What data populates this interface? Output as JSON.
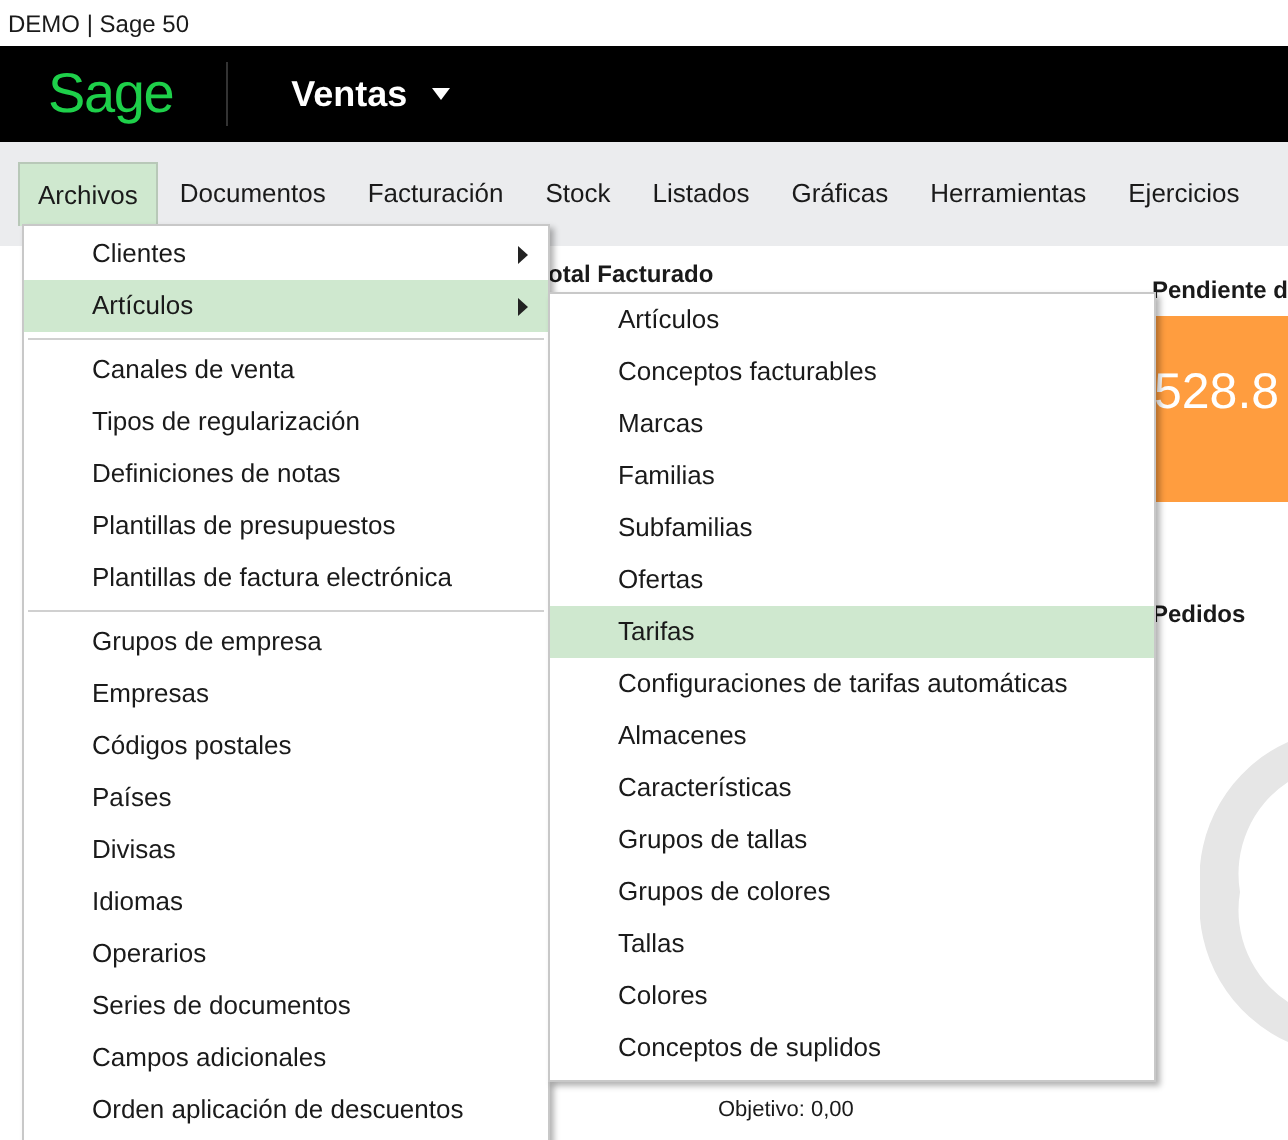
{
  "window": {
    "title": "DEMO | Sage 50"
  },
  "header": {
    "logo": "Sage",
    "module": "Ventas"
  },
  "menubar": [
    {
      "label": "Archivos",
      "selected": true
    },
    {
      "label": "Documentos",
      "selected": false
    },
    {
      "label": "Facturación",
      "selected": false
    },
    {
      "label": "Stock",
      "selected": false
    },
    {
      "label": "Listados",
      "selected": false
    },
    {
      "label": "Gráficas",
      "selected": false
    },
    {
      "label": "Herramientas",
      "selected": false
    },
    {
      "label": "Ejercicios",
      "selected": false
    }
  ],
  "dashboard": {
    "total_heading": "otal Facturado",
    "pending_heading": "Pendiente d",
    "pending_value": "528.8",
    "orders_heading": "Pedidos",
    "target": "Objetivo: 0,00"
  },
  "menu": {
    "items": [
      {
        "kind": "item",
        "label": "Clientes",
        "has_submenu": true,
        "selected": false
      },
      {
        "kind": "item",
        "label": "Artículos",
        "has_submenu": true,
        "selected": true
      },
      {
        "kind": "separator"
      },
      {
        "kind": "item",
        "label": "Canales de venta",
        "has_submenu": false,
        "selected": false
      },
      {
        "kind": "item",
        "label": "Tipos de regularización",
        "has_submenu": false,
        "selected": false
      },
      {
        "kind": "item",
        "label": "Definiciones de notas",
        "has_submenu": false,
        "selected": false
      },
      {
        "kind": "item",
        "label": "Plantillas de presupuestos",
        "has_submenu": false,
        "selected": false
      },
      {
        "kind": "item",
        "label": "Plantillas de factura electrónica",
        "has_submenu": false,
        "selected": false
      },
      {
        "kind": "separator"
      },
      {
        "kind": "item",
        "label": "Grupos de empresa",
        "has_submenu": false,
        "selected": false
      },
      {
        "kind": "item",
        "label": "Empresas",
        "has_submenu": false,
        "selected": false
      },
      {
        "kind": "item",
        "label": "Códigos postales",
        "has_submenu": false,
        "selected": false
      },
      {
        "kind": "item",
        "label": "Países",
        "has_submenu": false,
        "selected": false
      },
      {
        "kind": "item",
        "label": "Divisas",
        "has_submenu": false,
        "selected": false
      },
      {
        "kind": "item",
        "label": "Idiomas",
        "has_submenu": false,
        "selected": false
      },
      {
        "kind": "item",
        "label": "Operarios",
        "has_submenu": false,
        "selected": false
      },
      {
        "kind": "item",
        "label": "Series de documentos",
        "has_submenu": false,
        "selected": false
      },
      {
        "kind": "item",
        "label": "Campos adicionales",
        "has_submenu": false,
        "selected": false
      },
      {
        "kind": "item",
        "label": "Orden aplicación de descuentos",
        "has_submenu": false,
        "selected": false
      }
    ]
  },
  "submenu": {
    "items": [
      {
        "label": "Artículos",
        "selected": false
      },
      {
        "label": "Conceptos facturables",
        "selected": false
      },
      {
        "label": "Marcas",
        "selected": false
      },
      {
        "label": "Familias",
        "selected": false
      },
      {
        "label": "Subfamilias",
        "selected": false
      },
      {
        "label": "Ofertas",
        "selected": false
      },
      {
        "label": "Tarifas",
        "selected": true
      },
      {
        "label": "Configuraciones de tarifas automáticas",
        "selected": false
      },
      {
        "label": "Almacenes",
        "selected": false
      },
      {
        "label": "Características",
        "selected": false
      },
      {
        "label": "Grupos de tallas",
        "selected": false
      },
      {
        "label": "Grupos de colores",
        "selected": false
      },
      {
        "label": "Tallas",
        "selected": false
      },
      {
        "label": "Colores",
        "selected": false
      },
      {
        "label": "Conceptos de suplidos",
        "selected": false
      }
    ]
  }
}
